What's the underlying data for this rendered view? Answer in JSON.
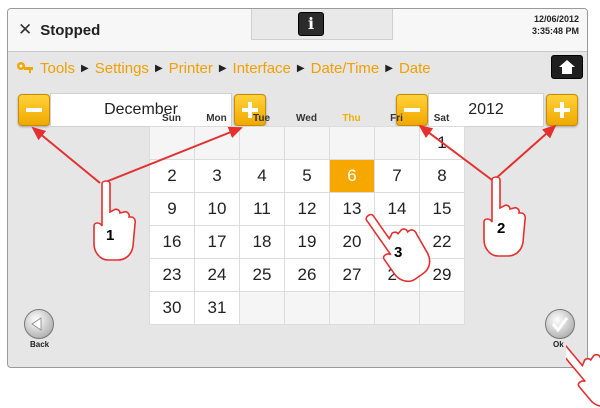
{
  "header": {
    "status": "Stopped",
    "status_icon": "x-icon",
    "info_icon": "info-icon",
    "date": "12/06/2012",
    "time": "3:35:48 PM"
  },
  "breadcrumb": {
    "items": [
      "Tools",
      "Settings",
      "Printer",
      "Interface",
      "Date/Time",
      "Date"
    ]
  },
  "month_picker": {
    "value": "December"
  },
  "year_picker": {
    "value": "2012"
  },
  "calendar": {
    "weekdays": [
      "Sun",
      "Mon",
      "Tue",
      "Wed",
      "Thu",
      "Fri",
      "Sat"
    ],
    "highlight_weekday": "Thu",
    "days": [
      "",
      "",
      "",
      "",
      "",
      "",
      "1",
      "2",
      "3",
      "4",
      "5",
      "6",
      "7",
      "8",
      "9",
      "10",
      "11",
      "12",
      "13",
      "14",
      "15",
      "16",
      "17",
      "18",
      "19",
      "20",
      "21",
      "22",
      "23",
      "24",
      "25",
      "26",
      "27",
      "28",
      "29",
      "30",
      "31",
      "",
      "",
      "",
      "",
      ""
    ],
    "selected_day": "6"
  },
  "back": {
    "label": "Back"
  },
  "ok": {
    "label": "Ok"
  },
  "callouts": [
    "1",
    "2",
    "3"
  ],
  "colors": {
    "accent": "#f0a800",
    "arrow": "#e53030"
  }
}
